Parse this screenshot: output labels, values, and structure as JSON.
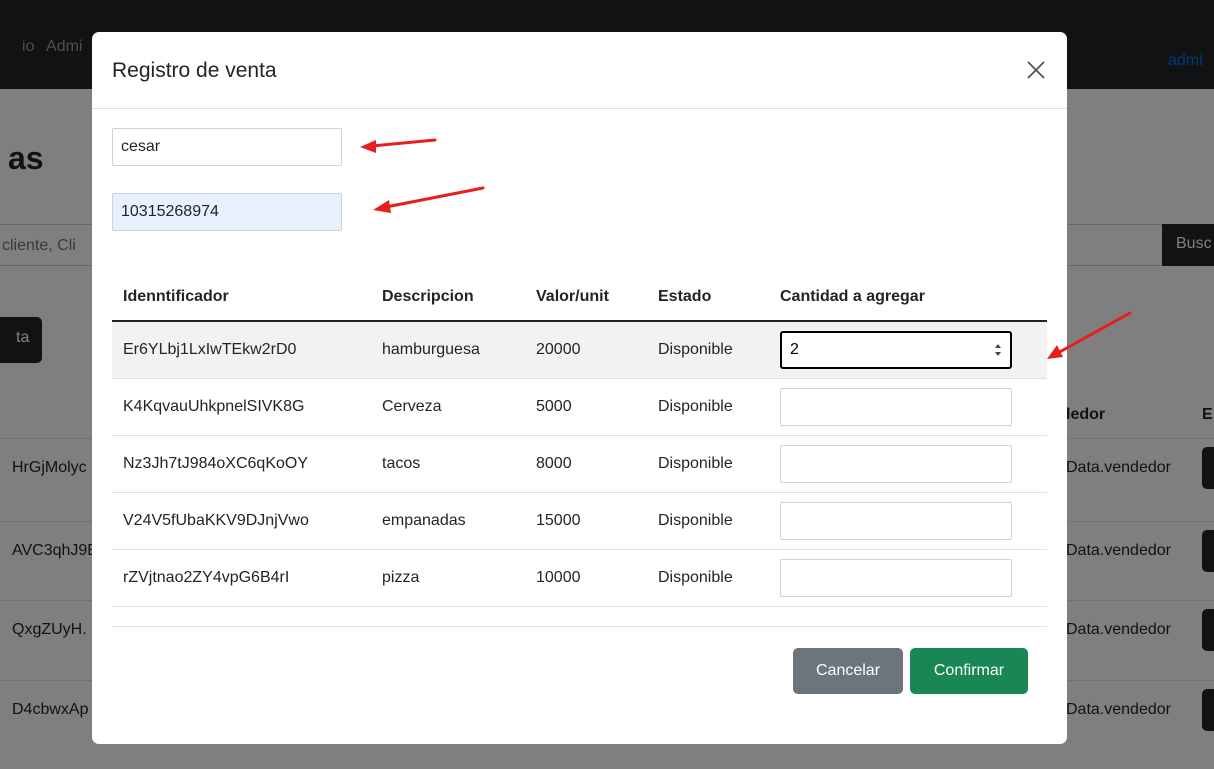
{
  "background": {
    "nav_left_items": [
      "io",
      "Admi"
    ],
    "nav_right": "admi",
    "title": "as",
    "search_placeholder": "cliente, Cli",
    "search_button": "Busc",
    "new_button": "ta",
    "col_vendor": "ledor",
    "col_e": "E",
    "rows": [
      {
        "id": "HrGjMolyc",
        "vendor": "Data.vendedor"
      },
      {
        "id": "AVC3qhJ9E",
        "vendor": "Data.vendedor"
      },
      {
        "id": "QxgZUyH.",
        "vendor": "Data.vendedor"
      },
      {
        "id": "D4cbwxAp",
        "vendor": "Data.vendedor"
      }
    ]
  },
  "modal": {
    "title": "Registro de venta",
    "close_icon": "close-icon",
    "name_value": "cesar",
    "doc_value": "10315268974",
    "table": {
      "headers": [
        "Idenntificador",
        "Descripcion",
        "Valor/unit",
        "Estado",
        "Cantidad a agregar"
      ],
      "rows": [
        {
          "id": "Er6YLbj1LxIwTEkw2rD0",
          "desc": "hamburguesa",
          "value": "20000",
          "status": "Disponible",
          "qty": "2"
        },
        {
          "id": "K4KqvauUhkpnelSIVK8G",
          "desc": "Cerveza",
          "value": "5000",
          "status": "Disponible",
          "qty": ""
        },
        {
          "id": "Nz3Jh7tJ984oXC6qKoOY",
          "desc": "tacos",
          "value": "8000",
          "status": "Disponible",
          "qty": ""
        },
        {
          "id": "V24V5fUbaKKV9DJnjVwo",
          "desc": "empanadas",
          "value": "15000",
          "status": "Disponible",
          "qty": ""
        },
        {
          "id": "rZVjtnao2ZY4vpG6B4rI",
          "desc": "pizza",
          "value": "10000",
          "status": "Disponible",
          "qty": ""
        }
      ]
    },
    "cancel_label": "Cancelar",
    "confirm_label": "Confirmar"
  },
  "colors": {
    "annotation_arrow": "#e61e1e",
    "confirm": "#198754",
    "cancel": "#6c757d",
    "navbar": "#212529"
  }
}
